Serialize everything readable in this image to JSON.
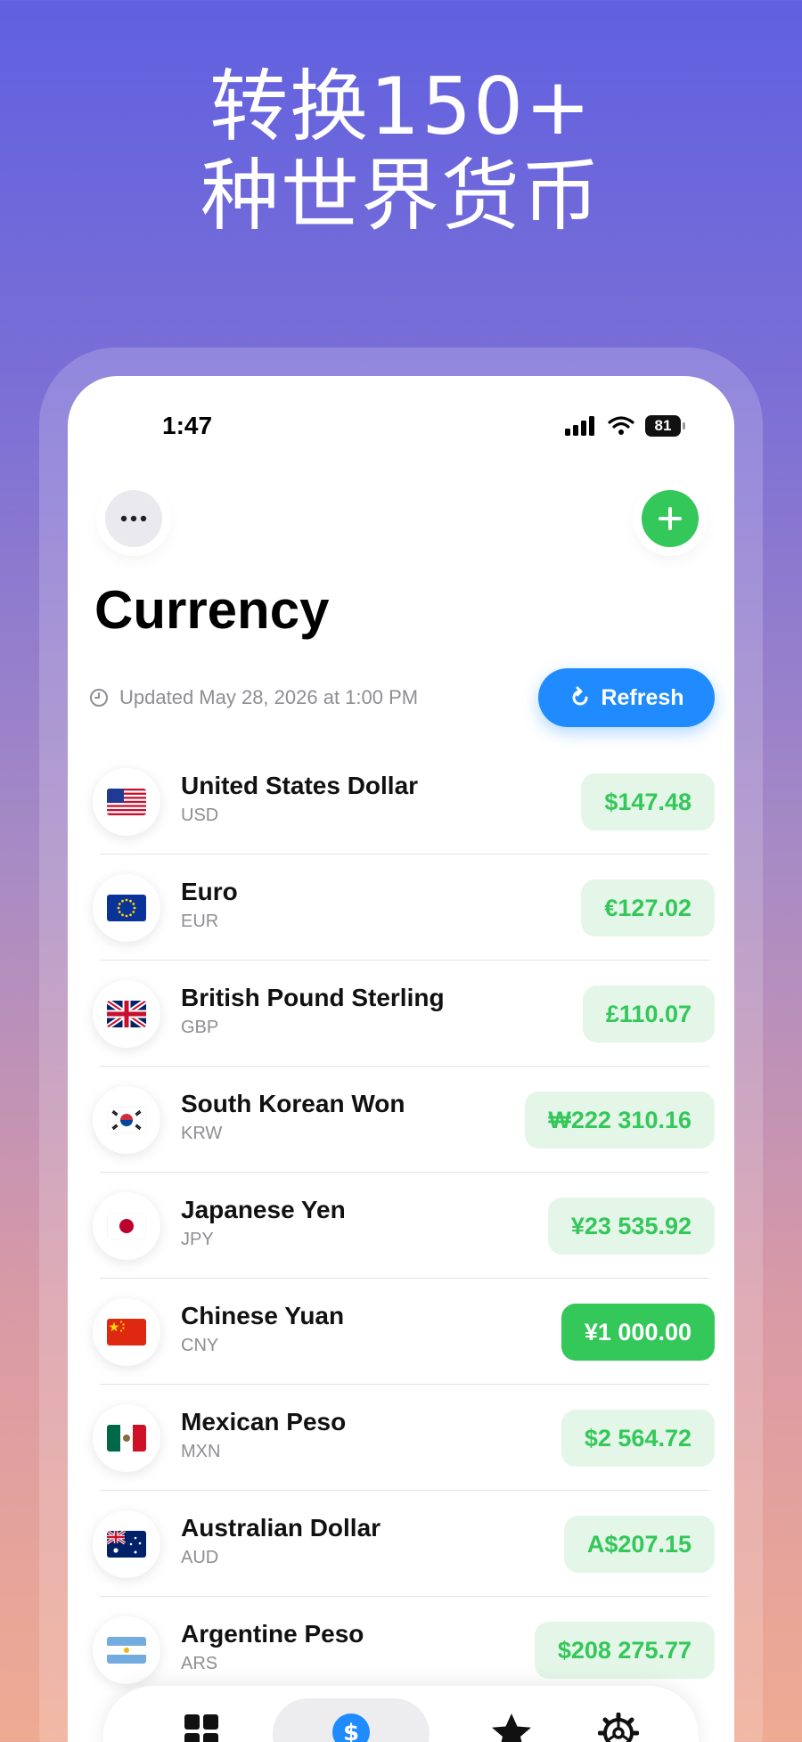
{
  "headline": {
    "line1": "转换150+",
    "line2": "种世界货币"
  },
  "status_bar": {
    "time": "1:47",
    "battery": "81"
  },
  "page": {
    "title": "Currency",
    "updated": "Updated May 28, 2026 at 1:00 PM",
    "refresh_label": "Refresh"
  },
  "currencies": [
    {
      "name": "United States Dollar",
      "code": "USD",
      "amount": "$147.48",
      "flag": "us-flag"
    },
    {
      "name": "Euro",
      "code": "EUR",
      "amount": "€127.02",
      "flag": "eu-flag"
    },
    {
      "name": "British Pound Sterling",
      "code": "GBP",
      "amount": "£110.07",
      "flag": "gb-flag"
    },
    {
      "name": "South Korean Won",
      "code": "KRW",
      "amount": "₩222 310.16",
      "flag": "kr-flag"
    },
    {
      "name": "Japanese Yen",
      "code": "JPY",
      "amount": "¥23 535.92",
      "flag": "jp-flag"
    },
    {
      "name": "Chinese Yuan",
      "code": "CNY",
      "amount": "¥1 000.00",
      "flag": "cn-flag",
      "active": true
    },
    {
      "name": "Mexican Peso",
      "code": "MXN",
      "amount": "$2 564.72",
      "flag": "mx-flag"
    },
    {
      "name": "Australian Dollar",
      "code": "AUD",
      "amount": "A$207.15",
      "flag": "au-flag"
    },
    {
      "name": "Argentine Peso",
      "code": "ARS",
      "amount": "$208 275.77",
      "flag": "ar-flag"
    }
  ],
  "tab_bar": {
    "tabs": [
      {
        "icon": "grid-icon"
      },
      {
        "icon": "dollar-icon",
        "active": true
      },
      {
        "icon": "star-icon"
      },
      {
        "icon": "settings-gear-icon"
      }
    ]
  },
  "colors": {
    "accent_green": "#34C759",
    "accent_blue": "#1F8BFF",
    "pill_green_bg": "#E3F6E8"
  }
}
